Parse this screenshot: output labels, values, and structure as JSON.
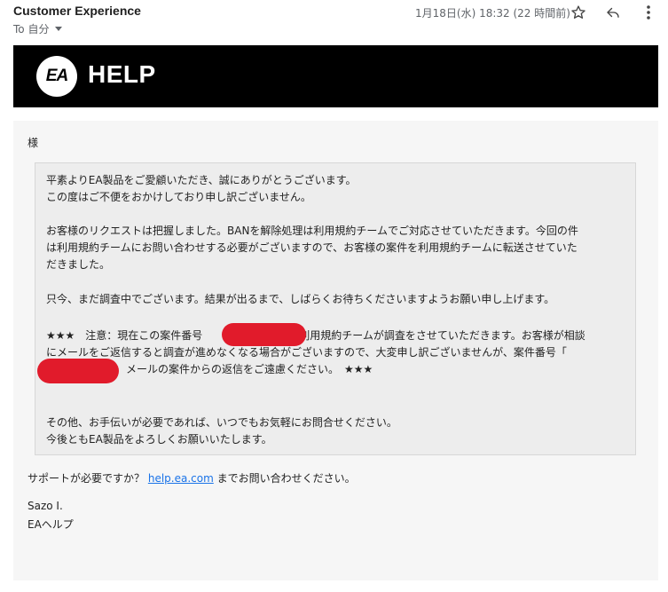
{
  "header": {
    "sender": "Customer Experience",
    "to_label": "To 自分",
    "date": "1月18日(水) 18:32 (22 時間前)"
  },
  "banner": {
    "logo_text": "EA",
    "help_text": "HELP"
  },
  "body": {
    "salutation": "様",
    "p1_l1": "平素よりEA製品をご愛顧いただき、誠にありがとうございます。",
    "p1_l2": "この度はご不便をおかけしており申し訳ございません。",
    "p2_l1": "お客様のリクエストは把握しました。BANを解除処理は利用規約チームでご対応させていただきます。今回の件",
    "p2_l2": "は利用規約チームにお問い合わせする必要がございますので、お客様の案件を利用規約チームに転送させていた",
    "p2_l3": "だきました。",
    "p3": "只今、まだ調査中でございます。結果が出るまで、しばらくお待ちくださいますようお願い申し上げます。",
    "p4_l1_a": "★★★　注意：現在この案件番号",
    "p4_l1_b": "が利用規約チームが調査をさせていただきます。お客様が相談",
    "p4_l2": "にメールをご返信すると調査が進めなくなる場合がございますので、大変申し訳ございませんが、案件番号「",
    "p4_l3": "メールの案件からの返信をご遠慮ください。　★★★",
    "p5_l1": "その他、お手伝いが必要であれば、いつでもお気軽にお問合せください。",
    "p5_l2": "今後ともEA製品をよろしくお願いいたします。"
  },
  "footer": {
    "support_prefix": "サポートが必要ですか？",
    "support_link": "help.ea.com",
    "support_suffix": "までお問い合わせください。",
    "sig_name": "Sazo I.",
    "sig_team": "EAヘルプ"
  },
  "colors": {
    "banner_bg": "#000000",
    "redaction": "#e11b2b",
    "link": "#1a73e8"
  }
}
